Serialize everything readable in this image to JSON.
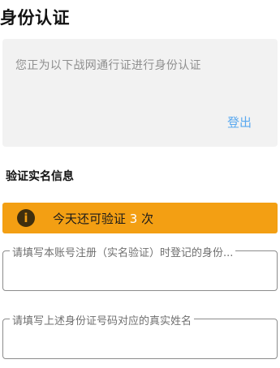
{
  "header": {
    "title": "身份认证"
  },
  "account": {
    "message": "您正为以下战网通行证进行身份认证",
    "logout_label": "登出"
  },
  "verify": {
    "section_title": "验证实名信息",
    "attempts_prefix": "今天还可验证",
    "attempts_count": "3",
    "attempts_suffix": "次",
    "warning_icon": "info-icon"
  },
  "form": {
    "field1_label": "请填写本账号注册（实名验证）时登记的身份...",
    "field2_label": "请填写上述身份证号码对应的真实姓名"
  },
  "colors": {
    "accent_link": "#5aa9f0",
    "warning_bar": "#f39f13"
  }
}
